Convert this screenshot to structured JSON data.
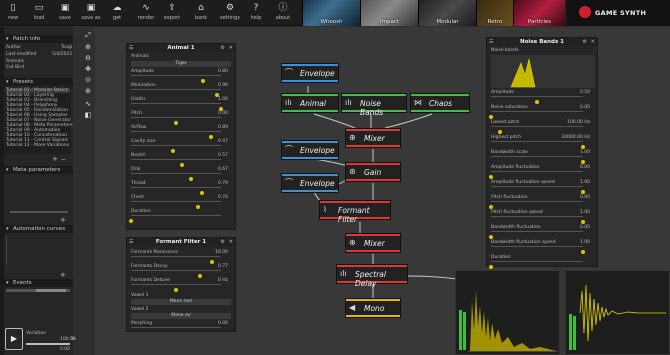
{
  "toolbar": {
    "buttons": [
      {
        "label": "new",
        "icon": "page-icon"
      },
      {
        "label": "load",
        "icon": "folder-icon"
      },
      {
        "label": "save",
        "icon": "disk-icon"
      },
      {
        "label": "save as",
        "icon": "disk-as-icon"
      },
      {
        "label": "get",
        "icon": "cloud-icon"
      },
      {
        "label": "render",
        "icon": "wave-icon"
      },
      {
        "label": "export",
        "icon": "export-icon"
      },
      {
        "label": "bank",
        "icon": "bank-icon"
      },
      {
        "label": "settings",
        "icon": "gear-icon"
      },
      {
        "label": "help",
        "icon": "help-icon"
      },
      {
        "label": "about",
        "icon": "info-icon"
      }
    ],
    "presets": [
      "Whoosh",
      "Impact",
      "Modular",
      "Retro",
      "Particles"
    ],
    "brand": "GAME SYNTH"
  },
  "sidebar": {
    "patch_info": {
      "header": "Patch info",
      "rows": [
        {
          "k": "Author",
          "v": "Tsugi"
        },
        {
          "k": "Last modified",
          "v": "5/4/2022"
        },
        {
          "k": "Animals",
          "v": ""
        },
        {
          "k": "Cat Bird",
          "v": ""
        }
      ]
    },
    "presets": {
      "header": "Presets",
      "items": [
        "Tutorial 01 - Modular Basics",
        "Tutorial 02 - Layering",
        "Tutorial 03 - Branching",
        "Tutorial 04 - Polyphony",
        "Tutorial 05 - Randomization",
        "Tutorial 06 - Using Samples",
        "Tutorial 07 - Noise Generator",
        "Tutorial 08 - Meta Parameters",
        "Tutorial 09 - Automation",
        "Tutorial 10 - Concatenation",
        "Tutorial 11 - Control Signals",
        "Tutorial 12 - More Variations"
      ]
    },
    "meta_parameters": {
      "header": "Meta parameters"
    },
    "automation_curves": {
      "header": "Automation curves"
    },
    "events": {
      "header": "Events"
    },
    "variation": {
      "label": "Variation",
      "value": "100.00",
      "unit": "%",
      "value2": "0.00"
    }
  },
  "animal_panel": {
    "title": "Animal 1",
    "section": "Animals",
    "preset": "Tiger",
    "params": [
      {
        "label": "Amplitude",
        "value": "0.80",
        "f": 0.8
      },
      {
        "label": "Modulation",
        "value": "0.96",
        "f": 0.96
      },
      {
        "label": "Glottis",
        "value": "1.00",
        "f": 1.0
      },
      {
        "label": "Pitch",
        "value": "0.00",
        "f": 0.5
      },
      {
        "label": "Airflow",
        "value": "0.89",
        "f": 0.89
      },
      {
        "label": "Cavity size",
        "value": "0.47",
        "f": 0.47
      },
      {
        "label": "Nostril",
        "value": "0.57",
        "f": 0.57
      },
      {
        "label": "Oral",
        "value": "0.67",
        "f": 0.67
      },
      {
        "label": "Throat",
        "value": "0.79",
        "f": 0.79
      },
      {
        "label": "Chest",
        "value": "0.74",
        "f": 0.74
      },
      {
        "label": "Duration",
        "value": "",
        "f": 0.0
      }
    ]
  },
  "formant_panel": {
    "title": "Formant Filter 1",
    "params": [
      {
        "label": "Formants Resonance",
        "value": "16.00",
        "f": 0.9
      },
      {
        "label": "Formants Decay",
        "value": "0.77",
        "f": 0.77
      },
      {
        "label": "Formants Detune",
        "value": "0 Hz",
        "f": 0.5
      }
    ],
    "vowel1_label": "Vowel 1",
    "vowel1": "Mane /ae/",
    "vowel2_label": "Vowel 2",
    "vowel2": "Mane /e/",
    "morphing_label": "Morphing",
    "morphing": "0.00"
  },
  "noise_panel": {
    "title": "Noise Bands 1",
    "section": "Noise bands",
    "params": [
      {
        "label": "Amplitude",
        "value": "0.50",
        "f": 0.5
      },
      {
        "label": "Noise saturation",
        "value": "0.00",
        "f": 0.0
      },
      {
        "label": "Lowest pitch",
        "value": "100.00 Hz",
        "f": 0.1
      },
      {
        "label": "Highest pitch",
        "value": "20000.00 Hz",
        "f": 1.0
      },
      {
        "label": "Bandwidth scale",
        "value": "1.00",
        "f": 1.0
      },
      {
        "label": "Amplitude fluctuation",
        "value": "0.00",
        "f": 0.0
      },
      {
        "label": "Amplitude fluctuation speed",
        "value": "1.00",
        "f": 1.0
      },
      {
        "label": "Pitch fluctuation",
        "value": "0.00",
        "f": 0.0
      },
      {
        "label": "Pitch fluctuation speed",
        "value": "1.00",
        "f": 1.0
      },
      {
        "label": "Bandwidth fluctuation",
        "value": "0.00",
        "f": 0.0
      },
      {
        "label": "Bandwidth fluctuation speed",
        "value": "1.00",
        "f": 1.0
      },
      {
        "label": "Duration",
        "value": "",
        "f": 0.0
      }
    ]
  },
  "nodes": {
    "envelope1": "Envelope",
    "animal": "Animal",
    "noise": "Noise Bands",
    "chaos": "Chaos",
    "mixer1": "Mixer",
    "envelope2": "Envelope",
    "envelope3": "Envelope",
    "gain": "Gain",
    "formant": "Formant Filter",
    "mixer2": "Mixer",
    "spectral": "Spectral Delay",
    "mono": "Mono"
  },
  "colors": {
    "accent": "#d8c800",
    "generator": "#3fbf3f",
    "envelope": "#3f8fd8",
    "filter": "#d83838",
    "output": "#e0b400"
  }
}
